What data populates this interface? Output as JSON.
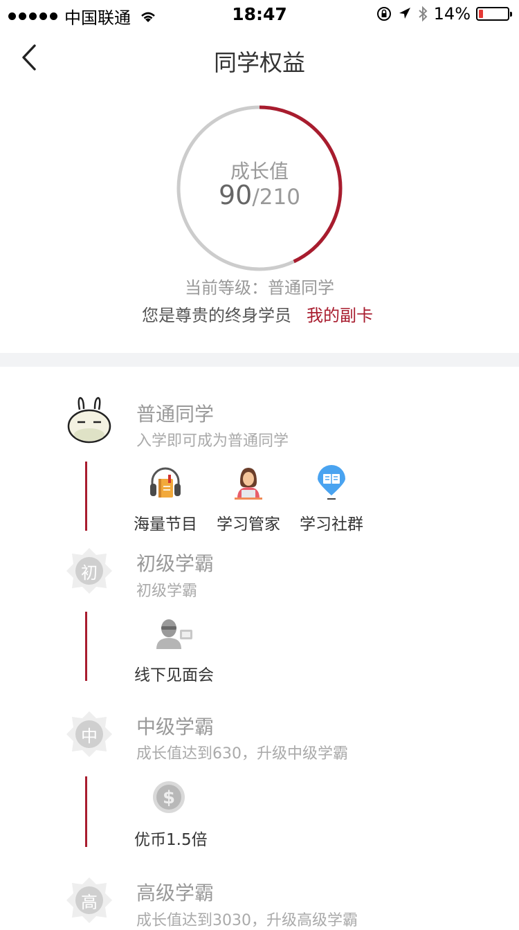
{
  "status_bar": {
    "carrier": "中国联通",
    "time": "18:47",
    "battery": "14%"
  },
  "nav": {
    "title": "同学权益"
  },
  "growth": {
    "label": "成长值",
    "current": "90",
    "total": "/210",
    "progress": 0.43
  },
  "profile": {
    "level_text": "当前等级：普通同学",
    "member_text": "您是尊贵的终身学员",
    "card_link": "我的副卡"
  },
  "tiers": [
    {
      "title": "普通同学",
      "desc": "入学即可成为普通同学",
      "badge": "rabbit-icon",
      "perks": [
        {
          "label": "海量节目",
          "icon": "headphones-book-icon"
        },
        {
          "label": "学习管家",
          "icon": "assistant-icon"
        },
        {
          "label": "学习社群",
          "icon": "community-icon"
        }
      ]
    },
    {
      "title": "初级学霸",
      "desc": "初级学霸",
      "badge_text": "初",
      "perks": [
        {
          "label": "线下见面会",
          "icon": "meetup-icon"
        }
      ]
    },
    {
      "title": "中级学霸",
      "desc": "成长值达到630，升级中级学霸",
      "badge_text": "中",
      "perks": [
        {
          "label": "优币1.5倍",
          "icon": "coin-icon"
        }
      ]
    },
    {
      "title": "高级学霸",
      "desc": "成长值达到3030，升级高级学霸",
      "badge_text": "高"
    }
  ],
  "colors": {
    "accent": "#a81c2e",
    "ring_track": "#cccccc",
    "divider": "#f2f3f5"
  }
}
